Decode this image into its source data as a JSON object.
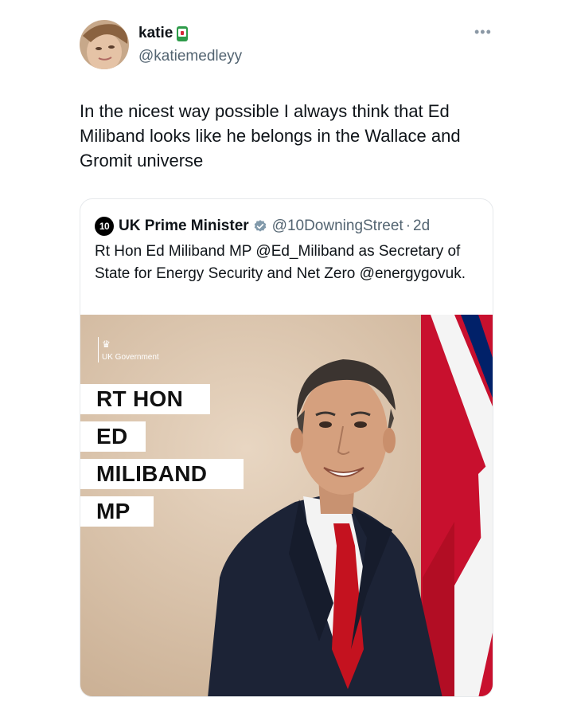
{
  "tweet": {
    "author_name": "katie",
    "author_handle": "@katiemedleyy",
    "more_icon": "more-dots-icon",
    "text": "In the nicest way possible I always think that Ed Miliband looks like he belongs in the Wallace and Gromit universe"
  },
  "quoted": {
    "logo_text": "10",
    "name": "UK Prime Minister",
    "verified_icon": "verified-badge-icon",
    "handle": "@10DowningStreet",
    "separator": "·",
    "time": "2d",
    "text": "Rt Hon Ed Miliband MP @Ed_Miliband as Secretary of State for Energy Security and Net Zero @energygovuk.",
    "image": {
      "org_label": "UK Government",
      "title_lines": [
        "RT HON",
        "ED",
        "MILIBAND",
        "MP"
      ]
    }
  },
  "colors": {
    "text_primary": "#0f1419",
    "text_secondary": "#536471",
    "verified": "#829aab",
    "flag_red": "#c8102e",
    "flag_blue": "#012169"
  }
}
